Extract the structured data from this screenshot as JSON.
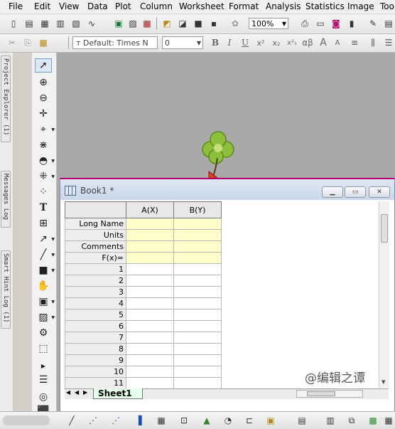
{
  "menu": [
    "File",
    "Edit",
    "View",
    "Data",
    "Plot",
    "Column",
    "Worksheet",
    "Format",
    "Analysis",
    "Statistics",
    "Image",
    "Too"
  ],
  "toolbar": {
    "zoom_value": "100%",
    "font_value": "Default: Times N",
    "font_size_value": "0",
    "format_buttons": [
      "B",
      "I",
      "U",
      "x²",
      "x₂",
      "x²₁",
      "αβ",
      "A",
      "A"
    ]
  },
  "dock_tabs": [
    "Project Explorer (1)",
    "Messages Log",
    "Smart Hint Log (1)"
  ],
  "book": {
    "title": "Book1 *",
    "columns": [
      "A(X)",
      "B(Y)"
    ],
    "header_rows": [
      "Long Name",
      "Units",
      "Comments",
      "F(x)="
    ],
    "row_numbers": [
      "1",
      "2",
      "3",
      "4",
      "5",
      "6",
      "7",
      "8",
      "9",
      "10",
      "11"
    ],
    "sheet_tab": "Sheet1"
  },
  "watermark": "@编辑之谭",
  "colors": {
    "accent": "#b4007a",
    "header_highlight": "#ffffcc",
    "workspace": "#a9a9a9"
  }
}
